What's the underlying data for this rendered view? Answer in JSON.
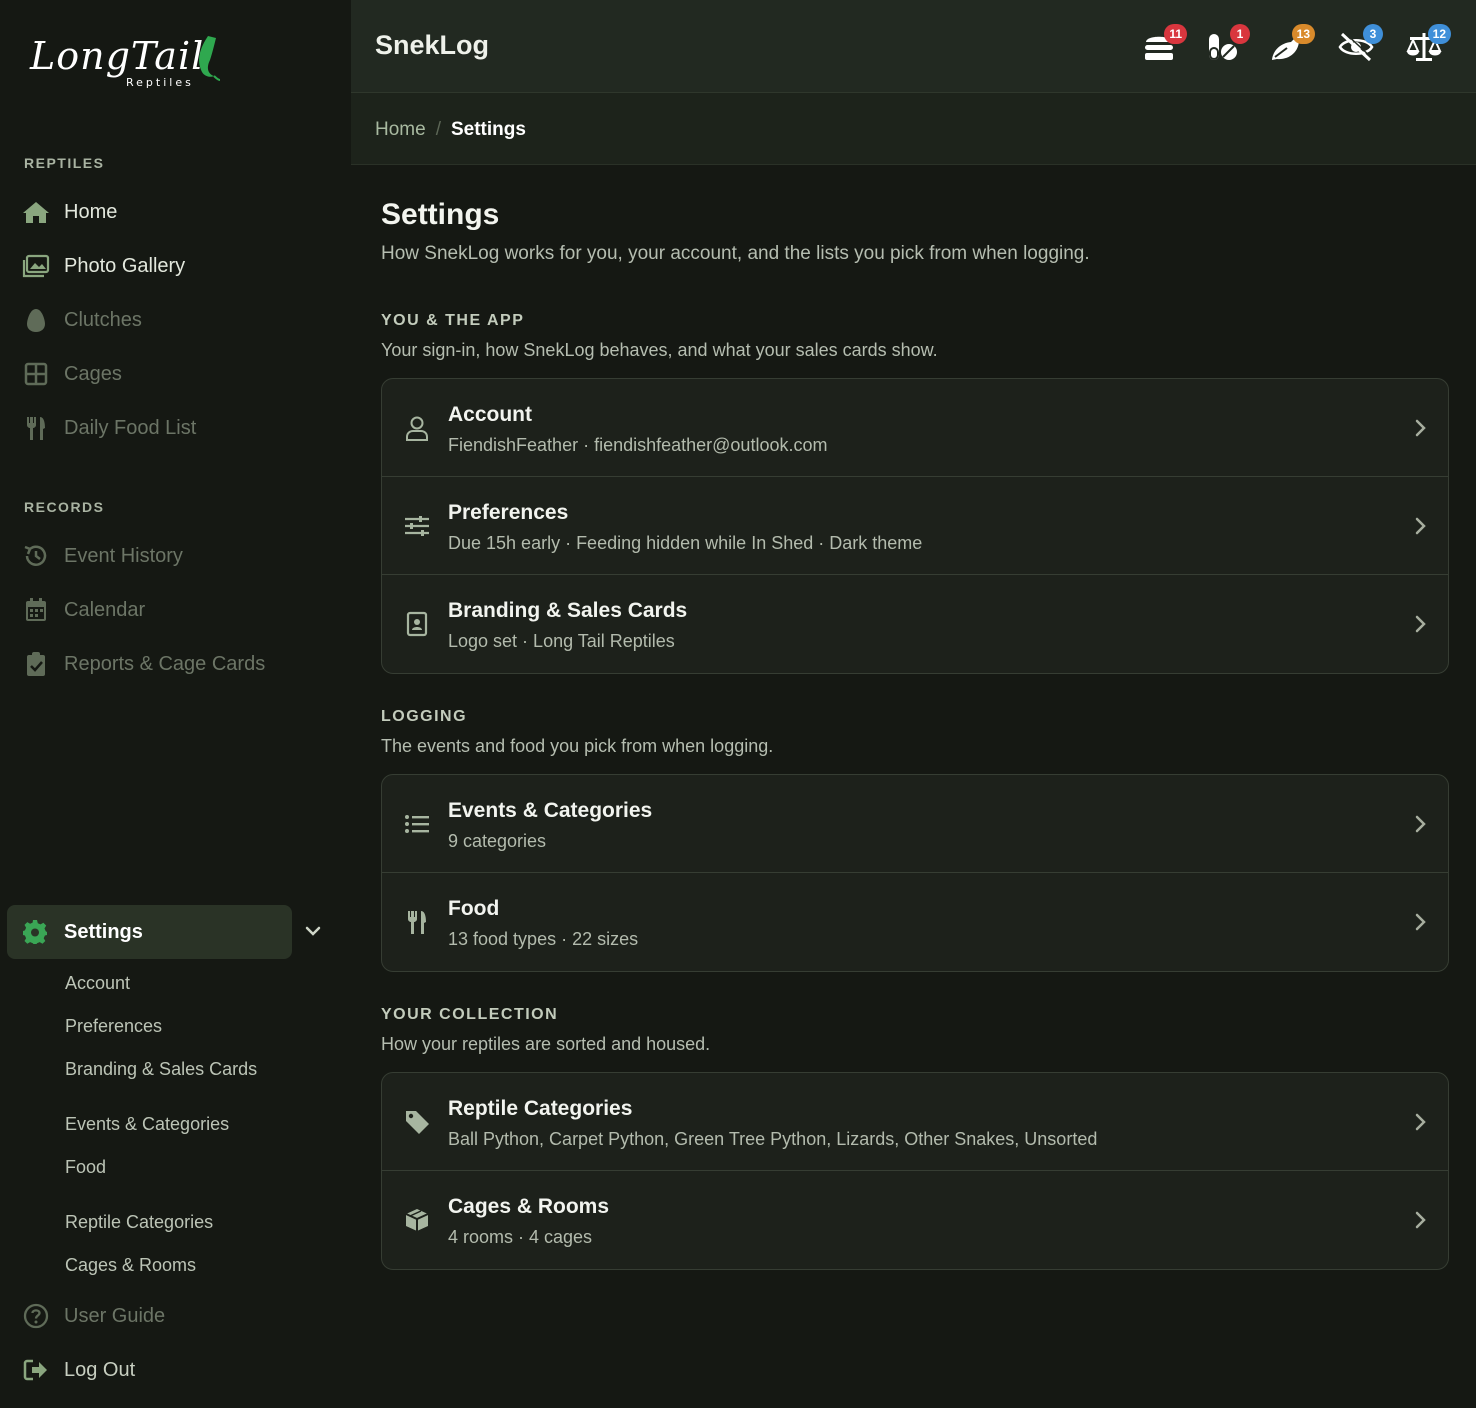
{
  "logo": {
    "word": "LongTail",
    "sub": "Reptiles"
  },
  "sidebar": {
    "reptiles_title": "REPTILES",
    "reptiles_items": [
      {
        "label": "Home",
        "icon": "home-icon"
      },
      {
        "label": "Photo Gallery",
        "icon": "photo-gallery-icon"
      },
      {
        "label": "Clutches",
        "icon": "egg-icon"
      },
      {
        "label": "Cages",
        "icon": "grid-icon"
      },
      {
        "label": "Daily Food List",
        "icon": "utensils-icon"
      }
    ],
    "records_title": "RECORDS",
    "records_items": [
      {
        "label": "Event History",
        "icon": "history-icon"
      },
      {
        "label": "Calendar",
        "icon": "calendar-icon"
      },
      {
        "label": "Reports & Cage Cards",
        "icon": "clipboard-check-icon"
      }
    ],
    "settings_label": "Settings",
    "settings_sub": [
      "Account",
      "Preferences",
      "Branding & Sales Cards",
      "Events & Categories",
      "Food",
      "Reptile Categories",
      "Cages & Rooms"
    ],
    "user_guide": "User Guide",
    "log_out": "Log Out"
  },
  "header": {
    "app_title": "SnekLog",
    "notifications": [
      {
        "icon": "feeding-stack-icon",
        "count": "11",
        "color": "#d9363e"
      },
      {
        "icon": "pills-icon",
        "count": "1",
        "color": "#d9363e"
      },
      {
        "icon": "leaf-brush-icon",
        "count": "13",
        "color": "#d98a2b"
      },
      {
        "icon": "eye-slash-icon",
        "count": "3",
        "color": "#3f8fd9"
      },
      {
        "icon": "scale-icon",
        "count": "12",
        "color": "#3f8fd9"
      }
    ]
  },
  "breadcrumb": {
    "home": "Home",
    "separator": "/",
    "current": "Settings"
  },
  "main": {
    "title": "Settings",
    "subtitle": "How SnekLog works for you, your account, and the lists you pick from when logging.",
    "groups": [
      {
        "title": "YOU & THE APP",
        "desc": "Your sign-in, how SnekLog behaves, and what your sales cards show.",
        "rows": [
          {
            "icon": "user-icon",
            "title": "Account",
            "sub": "FiendishFeather · fiendishfeather@outlook.com"
          },
          {
            "icon": "sliders-icon",
            "title": "Preferences",
            "sub": "Due 15h early · Feeding hidden while In Shed · Dark theme"
          },
          {
            "icon": "id-badge-icon",
            "title": "Branding & Sales Cards",
            "sub": "Logo set · Long Tail Reptiles"
          }
        ]
      },
      {
        "title": "LOGGING",
        "desc": "The events and food you pick from when logging.",
        "rows": [
          {
            "icon": "list-icon",
            "title": "Events & Categories",
            "sub": "9 categories"
          },
          {
            "icon": "utensils-icon",
            "title": "Food",
            "sub": "13 food types · 22 sizes"
          }
        ]
      },
      {
        "title": "YOUR COLLECTION",
        "desc": "How your reptiles are sorted and housed.",
        "rows": [
          {
            "icon": "tag-icon",
            "title": "Reptile Categories",
            "sub": "Ball Python, Carpet Python, Green Tree Python, Lizards, Other Snakes, Unsorted"
          },
          {
            "icon": "box-icon",
            "title": "Cages & Rooms",
            "sub": "4 rooms · 4 cages"
          }
        ]
      }
    ]
  },
  "colors": {
    "accent": "#3aa655",
    "active_bg": "#2a3326"
  }
}
